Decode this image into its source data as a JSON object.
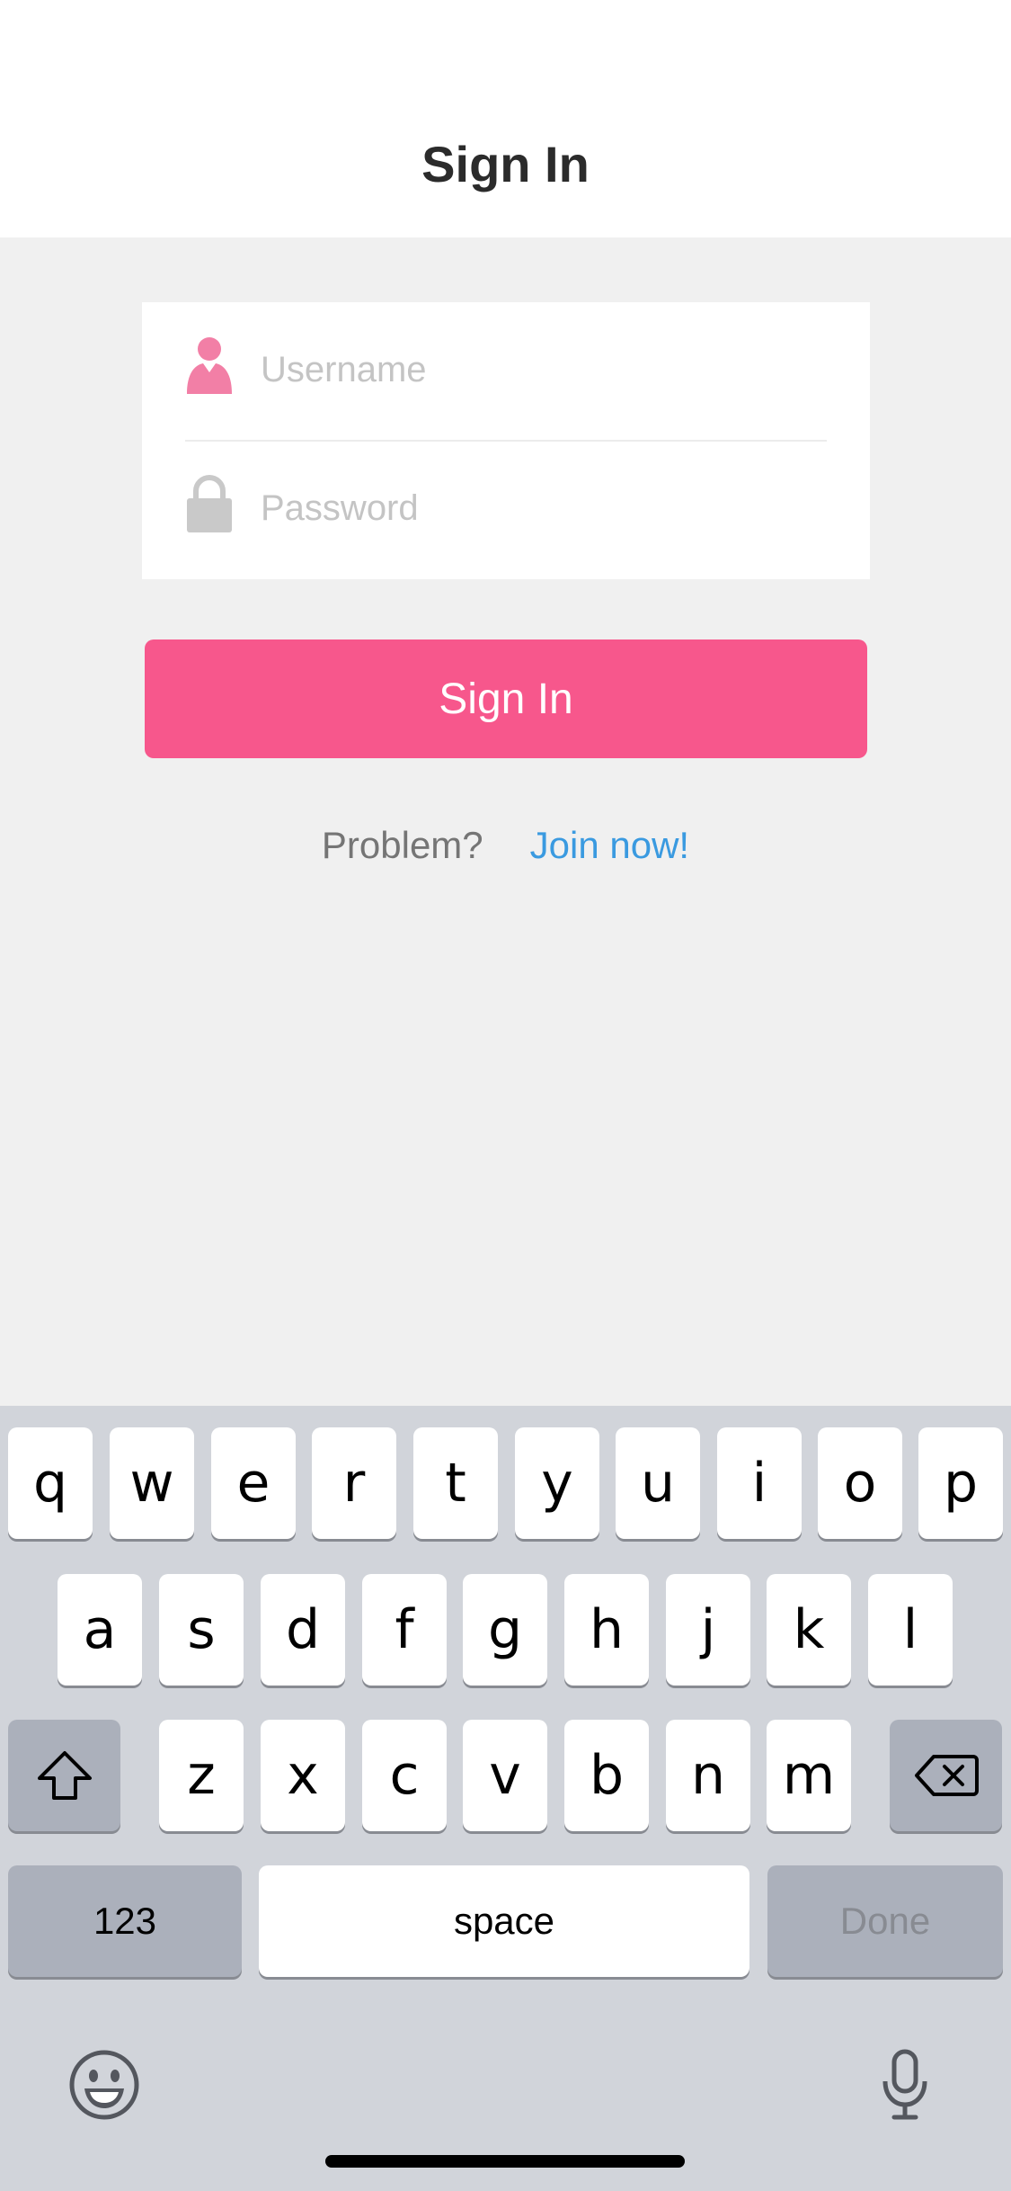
{
  "nav": {
    "title": "Sign In"
  },
  "form": {
    "username": {
      "placeholder": "Username",
      "value": ""
    },
    "password": {
      "placeholder": "Password",
      "value": ""
    }
  },
  "signin_button": {
    "label": "Sign In"
  },
  "links": {
    "problem": "Problem?",
    "join": "Join now!"
  },
  "keyboard": {
    "row1": [
      "q",
      "w",
      "e",
      "r",
      "t",
      "y",
      "u",
      "i",
      "o",
      "p"
    ],
    "row2": [
      "a",
      "s",
      "d",
      "f",
      "g",
      "h",
      "j",
      "k",
      "l"
    ],
    "row3": [
      "z",
      "x",
      "c",
      "v",
      "b",
      "n",
      "m"
    ],
    "numbers_key": "123",
    "space_key": "space",
    "done_key": "Done",
    "icons": [
      "shift-icon",
      "backspace-icon",
      "emoji-icon",
      "microphone-icon"
    ]
  },
  "colors": {
    "accent": "#f7578c",
    "link": "#3a9ae0",
    "user_icon": "#f27fa6",
    "lock_icon": "#c9c9c9"
  }
}
